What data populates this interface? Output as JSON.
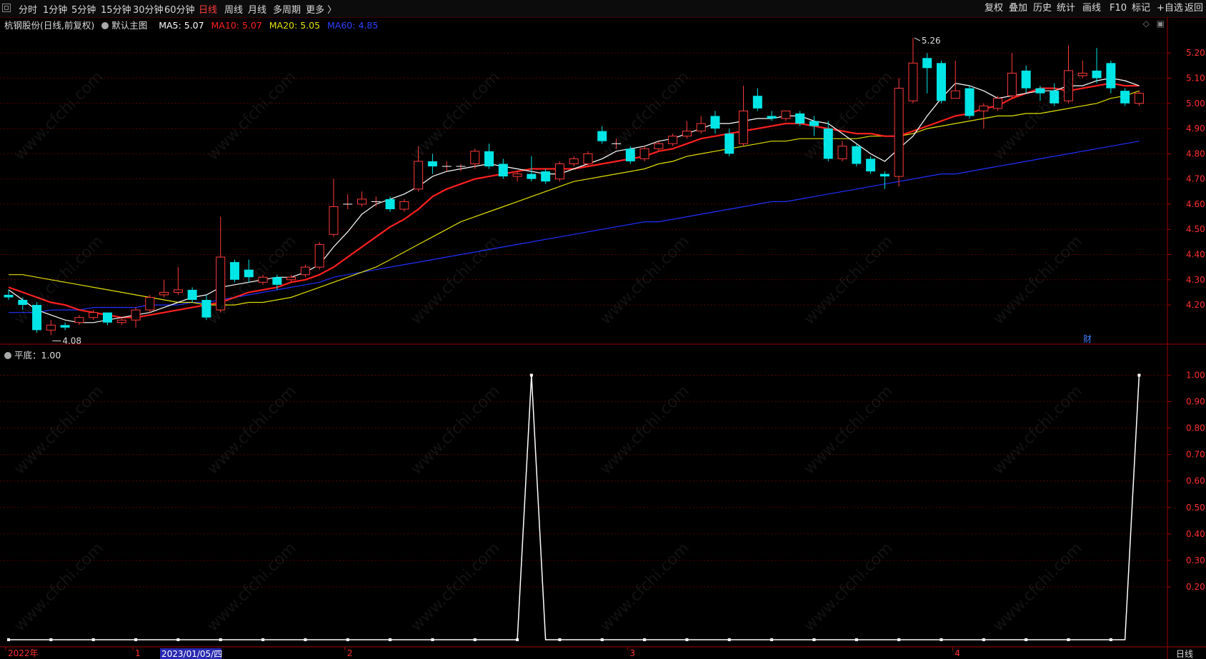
{
  "toolbar": {
    "left": [
      {
        "label": "分时",
        "active": false
      },
      {
        "label": "1分钟",
        "active": false
      },
      {
        "label": "5分钟",
        "active": false
      },
      {
        "label": "15分钟",
        "active": false
      },
      {
        "label": "30分钟",
        "active": false
      },
      {
        "label": "60分钟",
        "active": false
      },
      {
        "label": "日线",
        "active": true
      },
      {
        "label": "周线",
        "active": false
      },
      {
        "label": "月线",
        "active": false
      },
      {
        "label": "多周期",
        "active": false
      },
      {
        "label": "更多 〉",
        "active": false
      }
    ],
    "right": [
      "复权",
      "叠加",
      "历史",
      "统计",
      "画线",
      "F10",
      "标记",
      "+自选",
      "返回"
    ]
  },
  "legend": {
    "title": "杭钢股份(日线,前复权)",
    "main_indicator": "默认主图",
    "ma5": "MA5: 5.07",
    "ma10": "MA10: 5.07",
    "ma20": "MA20: 5.05",
    "ma60": "MA60: 4.85"
  },
  "indicator_legend": "平底：1.00",
  "annotations": {
    "high": "5.26",
    "low": "4.08",
    "fin_badge": "财"
  },
  "price_axis": [
    "5.20",
    "5.10",
    "5.00",
    "4.90",
    "4.80",
    "4.70",
    "4.60",
    "4.50",
    "4.40",
    "4.30",
    "4.20"
  ],
  "ind_axis": [
    "1.00",
    "0.90",
    "0.80",
    "0.70",
    "0.60",
    "0.50",
    "0.40",
    "0.30",
    "0.20"
  ],
  "time_axis": [
    {
      "label": "2022年",
      "idx": 0
    },
    {
      "label": "1",
      "idx": 9
    },
    {
      "label": "2",
      "idx": 24
    },
    {
      "label": "3",
      "idx": 44
    },
    {
      "label": "4",
      "idx": 67
    }
  ],
  "selected_date": "2023/01/05/四",
  "period_label": "日线",
  "watermark": "www.cfchi.com",
  "colors": {
    "up": "#ff3b3b",
    "down": "#00e5e5",
    "ma5": "#ffffff",
    "ma10": "#ff2020",
    "ma20": "#e0e000",
    "ma60": "#2030ff",
    "grid": "#5a0000",
    "axis": "#a00000"
  },
  "chart_data": {
    "type": "candlestick",
    "ylim": [
      4.05,
      5.28
    ],
    "candles": [
      [
        4.24,
        4.23,
        4.26,
        4.22
      ],
      [
        4.22,
        4.2,
        4.23,
        4.18
      ],
      [
        4.2,
        4.1,
        4.21,
        4.09
      ],
      [
        4.1,
        4.12,
        4.14,
        4.08
      ],
      [
        4.12,
        4.11,
        4.13,
        4.1
      ],
      [
        4.13,
        4.15,
        4.16,
        4.12
      ],
      [
        4.15,
        4.17,
        4.18,
        4.14
      ],
      [
        4.17,
        4.13,
        4.17,
        4.12
      ],
      [
        4.13,
        4.14,
        4.15,
        4.12
      ],
      [
        4.14,
        4.18,
        4.19,
        4.11
      ],
      [
        4.18,
        4.23,
        4.24,
        4.17
      ],
      [
        4.24,
        4.25,
        4.3,
        4.23
      ],
      [
        4.25,
        4.26,
        4.35,
        4.24
      ],
      [
        4.26,
        4.22,
        4.27,
        4.21
      ],
      [
        4.22,
        4.15,
        4.24,
        4.14
      ],
      [
        4.18,
        4.39,
        4.55,
        4.17
      ],
      [
        4.37,
        4.3,
        4.38,
        4.29
      ],
      [
        4.34,
        4.31,
        4.38,
        4.29
      ],
      [
        4.29,
        4.31,
        4.32,
        4.28
      ],
      [
        4.31,
        4.28,
        4.32,
        4.26
      ],
      [
        4.3,
        4.31,
        4.32,
        4.29
      ],
      [
        4.32,
        4.35,
        4.36,
        4.31
      ],
      [
        4.35,
        4.44,
        4.45,
        4.34
      ],
      [
        4.48,
        4.59,
        4.7,
        4.47
      ],
      [
        4.6,
        4.6,
        4.64,
        4.58
      ],
      [
        4.6,
        4.62,
        4.65,
        4.59
      ],
      [
        4.61,
        4.61,
        4.63,
        4.59
      ],
      [
        4.62,
        4.58,
        4.63,
        4.57
      ],
      [
        4.58,
        4.61,
        4.62,
        4.57
      ],
      [
        4.66,
        4.77,
        4.83,
        4.65
      ],
      [
        4.77,
        4.75,
        4.8,
        4.72
      ],
      [
        4.75,
        4.75,
        4.77,
        4.73
      ],
      [
        4.75,
        4.75,
        4.76,
        4.73
      ],
      [
        4.76,
        4.81,
        4.82,
        4.74
      ],
      [
        4.81,
        4.75,
        4.84,
        4.74
      ],
      [
        4.76,
        4.71,
        4.78,
        4.7
      ],
      [
        4.71,
        4.72,
        4.73,
        4.69
      ],
      [
        4.72,
        4.7,
        4.79,
        4.69
      ],
      [
        4.73,
        4.69,
        4.74,
        4.68
      ],
      [
        4.7,
        4.76,
        4.77,
        4.69
      ],
      [
        4.76,
        4.78,
        4.79,
        4.75
      ],
      [
        4.76,
        4.8,
        4.81,
        4.75
      ],
      [
        4.89,
        4.85,
        4.91,
        4.84
      ],
      [
        4.84,
        4.84,
        4.86,
        4.82
      ],
      [
        4.82,
        4.77,
        4.83,
        4.76
      ],
      [
        4.78,
        4.82,
        4.83,
        4.77
      ],
      [
        4.82,
        4.84,
        4.85,
        4.81
      ],
      [
        4.84,
        4.87,
        4.88,
        4.83
      ],
      [
        4.87,
        4.89,
        4.93,
        4.86
      ],
      [
        4.89,
        4.92,
        4.95,
        4.88
      ],
      [
        4.95,
        4.9,
        4.97,
        4.88
      ],
      [
        4.88,
        4.8,
        4.9,
        4.79
      ],
      [
        4.84,
        4.97,
        5.07,
        4.83
      ],
      [
        5.03,
        4.98,
        5.06,
        4.97
      ],
      [
        4.95,
        4.94,
        4.97,
        4.93
      ],
      [
        4.94,
        4.97,
        4.97,
        4.93
      ],
      [
        4.96,
        4.92,
        4.97,
        4.91
      ],
      [
        4.93,
        4.91,
        4.95,
        4.87
      ],
      [
        4.9,
        4.78,
        4.93,
        4.77
      ],
      [
        4.78,
        4.83,
        4.85,
        4.77
      ],
      [
        4.83,
        4.76,
        4.84,
        4.75
      ],
      [
        4.78,
        4.73,
        4.79,
        4.72
      ],
      [
        4.72,
        4.71,
        4.73,
        4.66
      ],
      [
        4.71,
        5.06,
        5.1,
        4.67
      ],
      [
        5.01,
        5.16,
        5.26,
        5.0
      ],
      [
        5.18,
        5.14,
        5.2,
        5.04
      ],
      [
        5.16,
        5.01,
        5.17,
        5.0
      ],
      [
        5.02,
        5.05,
        5.17,
        5.02
      ],
      [
        5.06,
        4.95,
        5.07,
        4.94
      ],
      [
        4.97,
        4.99,
        5.0,
        4.9
      ],
      [
        4.98,
        5.02,
        5.03,
        4.97
      ],
      [
        5.03,
        5.12,
        5.2,
        5.02
      ],
      [
        5.13,
        5.06,
        5.15,
        5.04
      ],
      [
        5.06,
        5.04,
        5.07,
        5.01
      ],
      [
        5.05,
        5.0,
        5.08,
        4.99
      ],
      [
        5.01,
        5.13,
        5.23,
        5.0
      ],
      [
        5.11,
        5.12,
        5.17,
        5.1
      ],
      [
        5.13,
        5.1,
        5.22,
        5.08
      ],
      [
        5.16,
        5.06,
        5.17,
        5.04
      ],
      [
        5.05,
        5.0,
        5.06,
        4.99
      ],
      [
        5.0,
        5.04,
        5.05,
        4.99
      ]
    ],
    "ma5": [
      4.26,
      4.22,
      4.18,
      4.16,
      4.14,
      4.13,
      4.13,
      4.14,
      4.15,
      4.16,
      4.17,
      4.19,
      4.21,
      4.23,
      4.24,
      4.27,
      4.28,
      4.29,
      4.3,
      4.31,
      4.31,
      4.33,
      4.36,
      4.43,
      4.49,
      4.56,
      4.6,
      4.62,
      4.64,
      4.67,
      4.71,
      4.73,
      4.74,
      4.75,
      4.76,
      4.75,
      4.74,
      4.73,
      4.72,
      4.72,
      4.74,
      4.76,
      4.78,
      4.81,
      4.82,
      4.83,
      4.85,
      4.86,
      4.88,
      4.9,
      4.92,
      4.92,
      4.93,
      4.94,
      4.94,
      4.95,
      4.95,
      4.93,
      4.92,
      4.88,
      4.84,
      4.8,
      4.77,
      4.82,
      4.87,
      4.95,
      5.02,
      5.08,
      5.07,
      5.05,
      5.02,
      5.03,
      5.04,
      5.05,
      5.05,
      5.07,
      5.07,
      5.09,
      5.1,
      5.09,
      5.07
    ],
    "ma10": [
      4.27,
      4.25,
      4.23,
      4.21,
      4.2,
      4.18,
      4.17,
      4.16,
      4.15,
      4.15,
      4.16,
      4.17,
      4.18,
      4.19,
      4.2,
      4.21,
      4.23,
      4.25,
      4.26,
      4.27,
      4.29,
      4.3,
      4.32,
      4.35,
      4.39,
      4.43,
      4.47,
      4.51,
      4.54,
      4.58,
      4.63,
      4.66,
      4.68,
      4.7,
      4.71,
      4.72,
      4.73,
      4.74,
      4.74,
      4.74,
      4.74,
      4.75,
      4.76,
      4.77,
      4.78,
      4.79,
      4.81,
      4.82,
      4.84,
      4.86,
      4.87,
      4.88,
      4.89,
      4.9,
      4.91,
      4.92,
      4.92,
      4.91,
      4.9,
      4.89,
      4.88,
      4.88,
      4.87,
      4.87,
      4.89,
      4.91,
      4.93,
      4.95,
      4.96,
      4.98,
      4.99,
      5.02,
      5.04,
      5.06,
      5.06,
      5.05,
      5.06,
      5.07,
      5.08,
      5.07,
      5.07
    ],
    "ma20": [
      4.32,
      4.32,
      4.31,
      4.3,
      4.29,
      4.28,
      4.27,
      4.26,
      4.25,
      4.24,
      4.23,
      4.22,
      4.21,
      4.21,
      4.2,
      4.2,
      4.2,
      4.21,
      4.21,
      4.22,
      4.23,
      4.25,
      4.27,
      4.29,
      4.31,
      4.33,
      4.35,
      4.38,
      4.41,
      4.44,
      4.47,
      4.5,
      4.53,
      4.55,
      4.57,
      4.59,
      4.61,
      4.63,
      4.65,
      4.67,
      4.69,
      4.7,
      4.71,
      4.72,
      4.73,
      4.74,
      4.76,
      4.77,
      4.79,
      4.8,
      4.81,
      4.82,
      4.83,
      4.84,
      4.85,
      4.85,
      4.86,
      4.86,
      4.86,
      4.86,
      4.86,
      4.87,
      4.87,
      4.87,
      4.88,
      4.9,
      4.91,
      4.92,
      4.93,
      4.94,
      4.95,
      4.95,
      4.96,
      4.96,
      4.97,
      4.98,
      4.99,
      5.0,
      5.02,
      5.03,
      5.05
    ],
    "ma60": [
      4.17,
      4.17,
      4.17,
      4.18,
      4.18,
      4.18,
      4.19,
      4.19,
      4.19,
      4.19,
      4.2,
      4.2,
      4.2,
      4.21,
      4.21,
      4.22,
      4.23,
      4.24,
      4.25,
      4.26,
      4.27,
      4.28,
      4.29,
      4.31,
      4.32,
      4.33,
      4.34,
      4.35,
      4.36,
      4.37,
      4.38,
      4.39,
      4.4,
      4.41,
      4.42,
      4.43,
      4.44,
      4.45,
      4.46,
      4.47,
      4.48,
      4.49,
      4.5,
      4.51,
      4.52,
      4.53,
      4.53,
      4.54,
      4.55,
      4.56,
      4.57,
      4.58,
      4.59,
      4.6,
      4.61,
      4.61,
      4.62,
      4.63,
      4.64,
      4.65,
      4.66,
      4.67,
      4.68,
      4.69,
      4.7,
      4.71,
      4.72,
      4.72,
      4.73,
      4.74,
      4.75,
      4.76,
      4.77,
      4.78,
      4.79,
      4.8,
      4.81,
      4.82,
      4.83,
      4.84,
      4.85
    ],
    "indicator": {
      "name": "平底",
      "ylim": [
        0,
        1.05
      ],
      "spikes": [
        37,
        80
      ],
      "marker_every": 3
    }
  }
}
